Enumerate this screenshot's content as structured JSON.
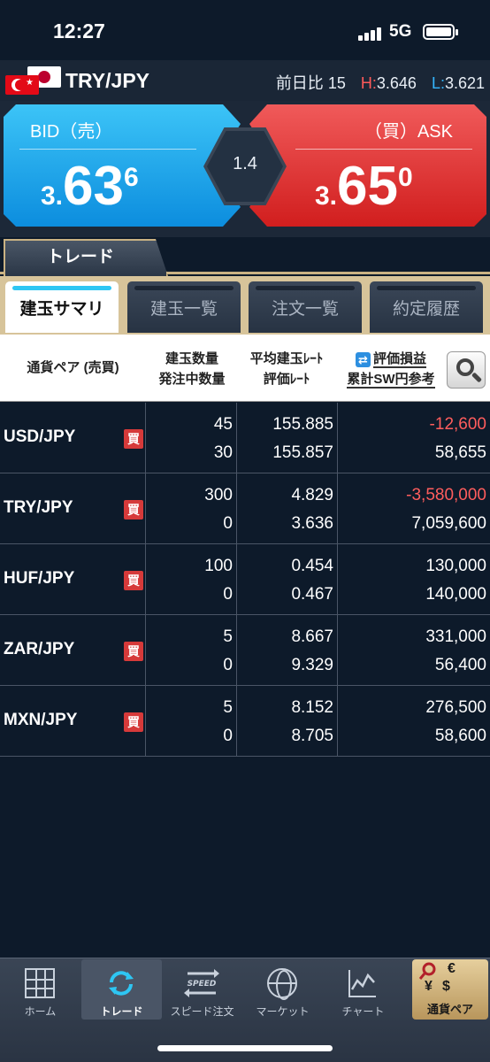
{
  "status": {
    "time": "12:27",
    "network": "5G"
  },
  "pair": {
    "name": "TRY/JPY",
    "change_label": "前日比",
    "change_value": "15",
    "high_label": "H:",
    "high_value": "3.646",
    "low_label": "L:",
    "low_value": "3.621"
  },
  "quote": {
    "bid_label": "BID（売）",
    "ask_label": "（買）ASK",
    "bid_small": "3.",
    "bid_big": "63",
    "bid_sup": "6",
    "ask_small": "3.",
    "ask_big": "65",
    "ask_sup": "0",
    "spread": "1.4",
    "bid_color": "#1aa6ec",
    "ask_color": "#e23a3a"
  },
  "trade_tab": "トレード",
  "subtabs": [
    "建玉サマリ",
    "建玉一覧",
    "注文一覧",
    "約定履歴"
  ],
  "table": {
    "h_pair": "通貨ペア (売買)",
    "h_qty1": "建玉数量",
    "h_qty2": "発注中数量",
    "h_rate1": "平均建玉ﾚｰﾄ",
    "h_rate2": "評価ﾚｰﾄ",
    "h_pl1": "評価損益",
    "h_pl2": "累計SW円参考",
    "toggle_icon": "swap-icon",
    "rows": [
      {
        "pair": "USD/JPY",
        "side": "買",
        "qty": "45",
        "pending": "30",
        "avg": "155.885",
        "rate": "155.857",
        "pl": "-12,600",
        "sw": "58,655"
      },
      {
        "pair": "TRY/JPY",
        "side": "買",
        "qty": "300",
        "pending": "0",
        "avg": "4.829",
        "rate": "3.636",
        "pl": "-3,580,000",
        "sw": "7,059,600"
      },
      {
        "pair": "HUF/JPY",
        "side": "買",
        "qty": "100",
        "pending": "0",
        "avg": "0.454",
        "rate": "0.467",
        "pl": "130,000",
        "sw": "140,000"
      },
      {
        "pair": "ZAR/JPY",
        "side": "買",
        "qty": "5",
        "pending": "0",
        "avg": "8.667",
        "rate": "9.329",
        "pl": "331,000",
        "sw": "56,400"
      },
      {
        "pair": "MXN/JPY",
        "side": "買",
        "qty": "5",
        "pending": "0",
        "avg": "8.152",
        "rate": "8.705",
        "pl": "276,500",
        "sw": "58,600"
      }
    ]
  },
  "nav": {
    "home": "ホーム",
    "trade": "トレード",
    "speed": "スピード注文",
    "speed_icon_text": "SPEED",
    "market": "マーケット",
    "chart": "チャート",
    "currency": "通貨ペア",
    "currency_symbols": [
      "€",
      "¥",
      "$"
    ]
  }
}
